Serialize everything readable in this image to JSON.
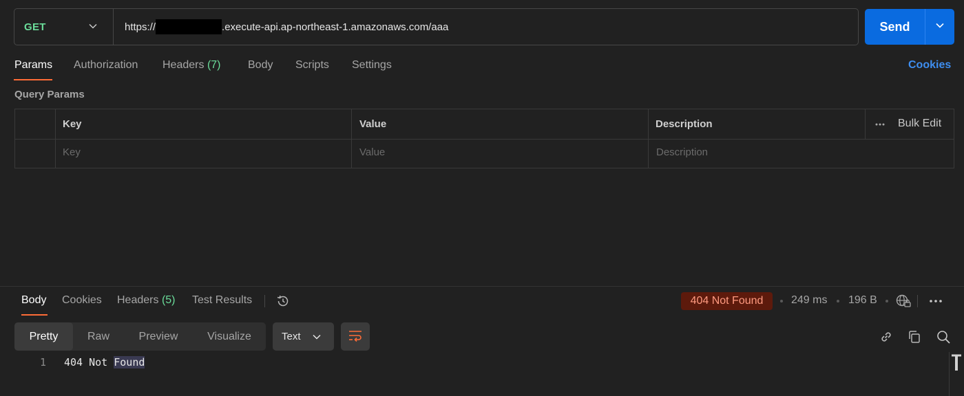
{
  "request": {
    "method": "GET",
    "url_prefix": "https://",
    "url_suffix": ".execute-api.ap-northeast-1.amazonaws.com/aaa",
    "send_label": "Send"
  },
  "request_tabs": {
    "params": "Params",
    "authorization": "Authorization",
    "headers": "Headers",
    "headers_count": "(7)",
    "body": "Body",
    "scripts": "Scripts",
    "settings": "Settings",
    "cookies": "Cookies"
  },
  "query_params": {
    "title": "Query Params",
    "columns": {
      "key": "Key",
      "value": "Value",
      "description": "Description"
    },
    "bulk_edit": "Bulk Edit",
    "placeholders": {
      "key": "Key",
      "value": "Value",
      "description": "Description"
    }
  },
  "response_tabs": {
    "body": "Body",
    "cookies": "Cookies",
    "headers": "Headers",
    "headers_count": "(5)",
    "test_results": "Test Results"
  },
  "response_meta": {
    "status": "404 Not Found",
    "time": "249 ms",
    "size": "196 B"
  },
  "view_modes": [
    "Pretty",
    "Raw",
    "Preview",
    "Visualize"
  ],
  "format": "Text",
  "response_body": {
    "line_number": "1",
    "text_before": "404 Not ",
    "text_highlight": "Found"
  },
  "colors": {
    "accent": "#ff6c37",
    "send": "#0a6be0",
    "method_get": "#6bdd9a",
    "link": "#3e8ef0",
    "status_bg": "#5d1a0c",
    "status_text": "#ff9a80"
  },
  "icons": [
    "chevron-down-icon",
    "history-icon",
    "globe-lock-icon",
    "more-horizontal-icon",
    "wrap-lines-icon",
    "link-icon",
    "copy-icon",
    "search-icon",
    "text-cursor-icon"
  ]
}
